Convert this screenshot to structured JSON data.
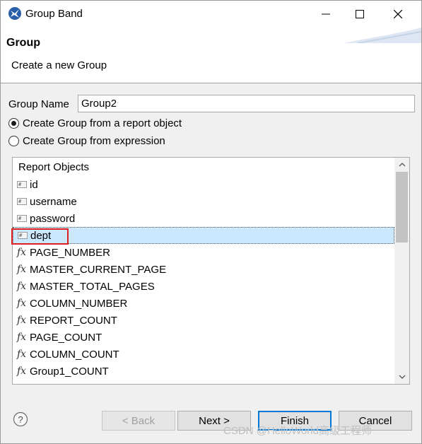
{
  "window": {
    "title": "Group Band"
  },
  "banner": {
    "title": "Group",
    "description": "Create a new Group"
  },
  "form": {
    "group_name_label": "Group Name",
    "group_name_value": "Group2",
    "radio_report_object": "Create Group from a report object",
    "radio_expression": "Create Group from expression",
    "selected_radio": "report_object"
  },
  "list": {
    "header": "Report Objects",
    "items": [
      {
        "label": "id",
        "icon": "field-icon"
      },
      {
        "label": "username",
        "icon": "field-icon"
      },
      {
        "label": "password",
        "icon": "field-icon"
      },
      {
        "label": "dept",
        "icon": "field-icon",
        "selected": true
      },
      {
        "label": "PAGE_NUMBER",
        "icon": "fx-icon"
      },
      {
        "label": "MASTER_CURRENT_PAGE",
        "icon": "fx-icon"
      },
      {
        "label": "MASTER_TOTAL_PAGES",
        "icon": "fx-icon"
      },
      {
        "label": "COLUMN_NUMBER",
        "icon": "fx-icon"
      },
      {
        "label": "REPORT_COUNT",
        "icon": "fx-icon"
      },
      {
        "label": "PAGE_COUNT",
        "icon": "fx-icon"
      },
      {
        "label": "COLUMN_COUNT",
        "icon": "fx-icon"
      },
      {
        "label": "Group1_COUNT",
        "icon": "fx-icon"
      }
    ]
  },
  "buttons": {
    "back": "< Back",
    "next": "Next >",
    "finish": "Finish",
    "cancel": "Cancel"
  },
  "watermark": "CSDN @HelloWorld高级工程师",
  "colors": {
    "selection": "#cce8ff",
    "highlight_border": "#e02020",
    "default_button_border": "#0078d7"
  }
}
